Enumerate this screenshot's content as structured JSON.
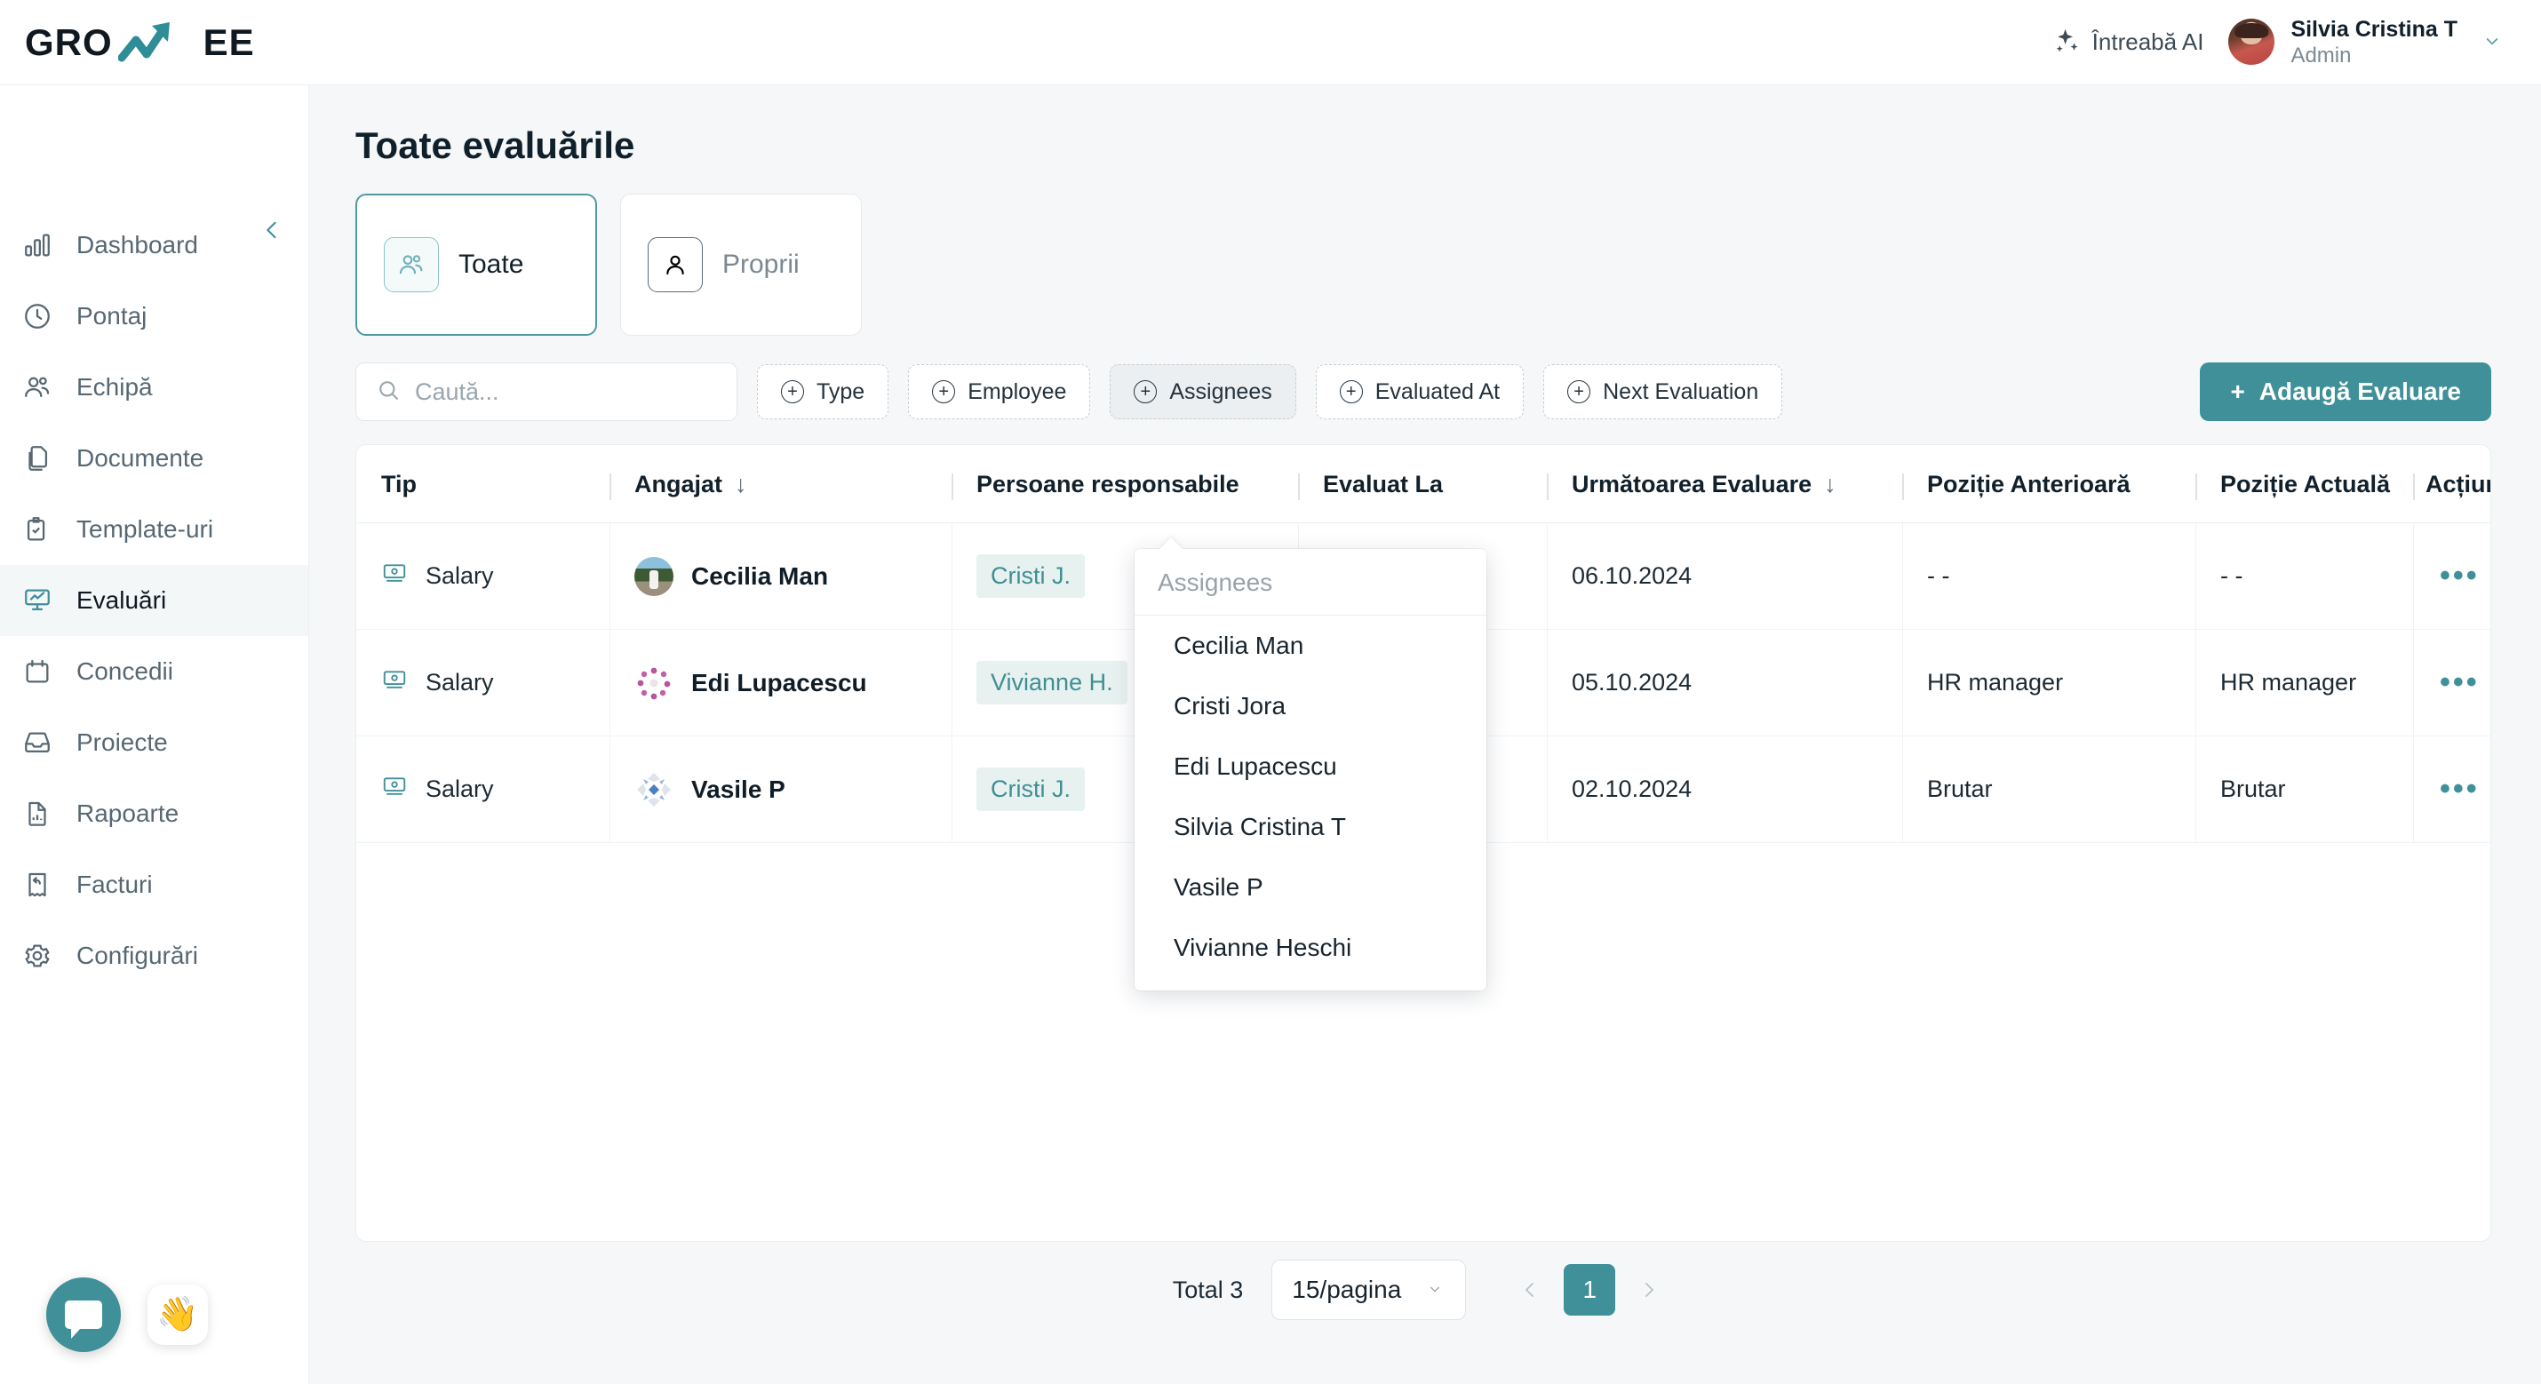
{
  "brand": {
    "name_left": "GRO",
    "name_right": "EE",
    "accent": "#3f9098",
    "logo_icon": "growth-arrow-icon"
  },
  "topbar": {
    "ask_ai_label": "Întreabă AI",
    "ask_ai_icon": "sparkles-icon",
    "user_name": "Silvia Cristina T",
    "user_role": "Admin",
    "avatar_icon": "user-avatar",
    "chevron_icon": "chevron-down-icon"
  },
  "sidebar": {
    "collapse_icon": "chevron-left-icon",
    "items": [
      {
        "label": "Dashboard",
        "icon": "bar-chart-icon",
        "active": false
      },
      {
        "label": "Pontaj",
        "icon": "clock-icon",
        "active": false
      },
      {
        "label": "Echipă",
        "icon": "users-icon",
        "active": false
      },
      {
        "label": "Documente",
        "icon": "copy-docs-icon",
        "active": false
      },
      {
        "label": "Template-uri",
        "icon": "clipboard-check-icon",
        "active": false
      },
      {
        "label": "Evaluări",
        "icon": "presentation-chart-icon",
        "active": true
      },
      {
        "label": "Concedii",
        "icon": "calendar-icon",
        "active": false
      },
      {
        "label": "Proiecte",
        "icon": "inbox-icon",
        "active": false
      },
      {
        "label": "Rapoarte",
        "icon": "file-chart-icon",
        "active": false
      },
      {
        "label": "Facturi",
        "icon": "receipt-refund-icon",
        "active": false
      },
      {
        "label": "Configurări",
        "icon": "gear-icon",
        "active": false
      }
    ],
    "chat_icon": "chat-bubble-icon",
    "wave_icon": "waving-hand-emoji",
    "wave_glyph": "👋"
  },
  "page": {
    "title": "Toate evaluările"
  },
  "mode_tabs": [
    {
      "label": "Toate",
      "icon": "users-icon",
      "selected": true
    },
    {
      "label": "Proprii",
      "icon": "user-icon",
      "selected": false
    }
  ],
  "search": {
    "placeholder": "Caută...",
    "value": "",
    "icon": "search-icon"
  },
  "filters": [
    {
      "label": "Type",
      "icon": "plus-circle-icon",
      "active": false
    },
    {
      "label": "Employee",
      "icon": "plus-circle-icon",
      "active": false
    },
    {
      "label": "Assignees",
      "icon": "plus-circle-icon",
      "active": true
    },
    {
      "label": "Evaluated At",
      "icon": "plus-circle-icon",
      "active": false
    },
    {
      "label": "Next Evaluation",
      "icon": "plus-circle-icon",
      "active": false
    }
  ],
  "add_button": {
    "label": "Adaugă Evaluare",
    "icon": "plus-icon"
  },
  "assignees_dropdown": {
    "open": true,
    "input_placeholder": "Assignees",
    "input_value": "",
    "options": [
      "Cecilia Man",
      "Cristi Jora",
      "Edi Lupacescu",
      "Silvia Cristina T",
      "Vasile P",
      "Vivianne Heschi"
    ]
  },
  "table": {
    "columns": [
      {
        "label": "Tip",
        "sortable": false,
        "sort_icon": ""
      },
      {
        "label": "Angajat",
        "sortable": true,
        "sort_icon": "↓"
      },
      {
        "label": "Persoane responsabile",
        "sortable": false,
        "sort_icon": ""
      },
      {
        "label": "Evaluat La",
        "sortable": false,
        "sort_icon": ""
      },
      {
        "label": "Următoarea Evaluare",
        "sortable": true,
        "sort_icon": "↓"
      },
      {
        "label": "Poziție Anterioară",
        "sortable": false,
        "sort_icon": ""
      },
      {
        "label": "Poziție Actuală",
        "sortable": false,
        "sort_icon": ""
      },
      {
        "label": "Acțiuni",
        "sortable": false,
        "sort_icon": "",
        "icon": "columns-icon"
      }
    ],
    "rows": [
      {
        "type": "Salary",
        "type_icon": "salary-icon",
        "employee": "Cecilia Man",
        "avatar": "photo-avatar",
        "assignee": "Cristi J.",
        "evaluated_at": "",
        "next_evaluation": "06.10.2024",
        "previous_position": "- -",
        "current_position": "- -",
        "actions_icon": "ellipsis-icon"
      },
      {
        "type": "Salary",
        "type_icon": "salary-icon",
        "employee": "Edi Lupacescu",
        "avatar": "pink-identicon",
        "assignee": "Vivianne H.",
        "evaluated_at": "",
        "next_evaluation": "05.10.2024",
        "previous_position": "HR manager",
        "current_position": "HR manager",
        "actions_icon": "ellipsis-icon"
      },
      {
        "type": "Salary",
        "type_icon": "salary-icon",
        "employee": "Vasile P",
        "avatar": "blue-identicon",
        "assignee": "Cristi J.",
        "evaluated_at": "",
        "next_evaluation": "02.10.2024",
        "previous_position": "Brutar",
        "current_position": "Brutar",
        "actions_icon": "ellipsis-icon"
      }
    ]
  },
  "footer": {
    "total_label": "Total 3",
    "per_page_label": "15/pagina",
    "per_page_chevron_icon": "chevron-down-icon",
    "prev_icon": "chevron-left-icon",
    "next_icon": "chevron-right-icon",
    "current_page": "1"
  }
}
